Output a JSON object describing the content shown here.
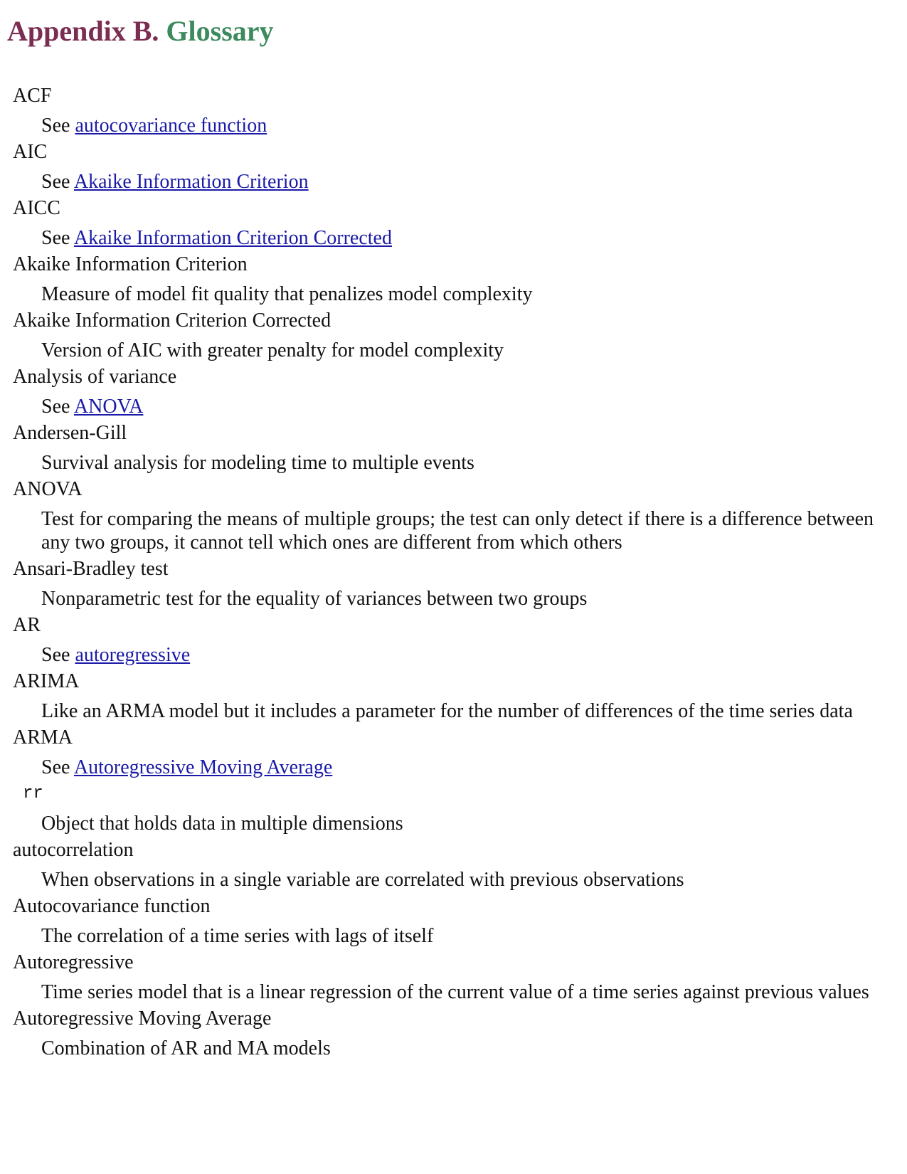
{
  "page": {
    "title_prefix": "Appendix B.",
    "title_name": "Glossary"
  },
  "colors": {
    "title_prefix": "#7b2d52",
    "title_name": "#3d8a5e",
    "link": "#1a1aa8"
  },
  "entries": [
    {
      "term": "ACF",
      "see_prefix": "See",
      "link": "autocovariance function"
    },
    {
      "term": "AIC",
      "see_prefix": "See",
      "link": "Akaike Information Criterion"
    },
    {
      "term": "AICC",
      "see_prefix": "See",
      "link": "Akaike Information Criterion Corrected"
    },
    {
      "term": "Akaike Information Criterion",
      "definition": "Measure of model fit quality that penalizes model complexity"
    },
    {
      "term": "Akaike Information Criterion Corrected",
      "definition": "Version of AIC with greater penalty for model complexity"
    },
    {
      "term": "Analysis of variance",
      "see_prefix": "See",
      "link": "ANOVA"
    },
    {
      "term": "Andersen-Gill",
      "definition": "Survival analysis for modeling time to multiple events"
    },
    {
      "term": "ANOVA",
      "definition": "Test for comparing the means of multiple groups; the test can only detect if there is a difference between any two groups, it cannot tell which ones are different from which others"
    },
    {
      "term": "Ansari-Bradley test",
      "definition": "Nonparametric test for the equality of variances between two groups"
    },
    {
      "term": "AR",
      "see_prefix": "See",
      "link": "autoregressive"
    },
    {
      "term": "ARIMA",
      "definition": "Like an ARMA model but it includes a parameter for the number of differences of the time series data"
    },
    {
      "term": "ARMA",
      "see_prefix": "See",
      "link": "Autoregressive Moving Average"
    },
    {
      "term": "rr",
      "code": true,
      "definition": "Object that holds data in multiple dimensions"
    },
    {
      "term": "autocorrelation",
      "definition": "When observations in a single variable are correlated with previous observations"
    },
    {
      "term": "Autocovariance function",
      "definition": "The correlation of a time series with lags of itself"
    },
    {
      "term": "Autoregressive",
      "definition": "Time series model that is a linear regression of the current value of a time series against previous values"
    },
    {
      "term": "Autoregressive Moving Average",
      "definition": "Combination of AR and MA models"
    }
  ]
}
